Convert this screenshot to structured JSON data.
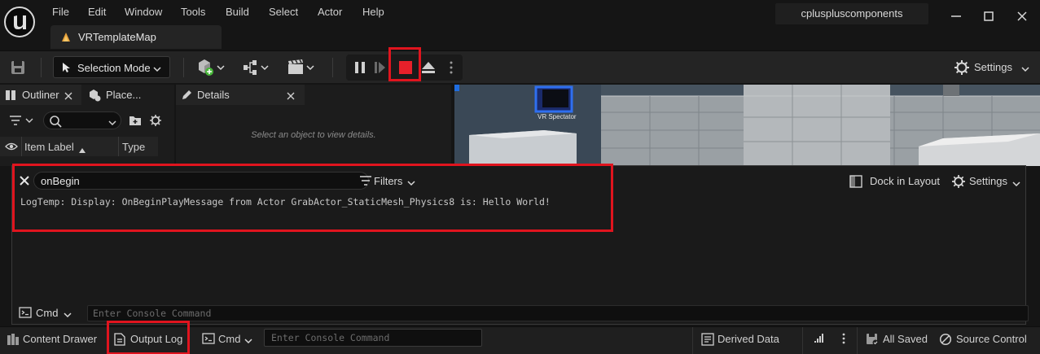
{
  "menu": [
    "File",
    "Edit",
    "Window",
    "Tools",
    "Build",
    "Select",
    "Actor",
    "Help"
  ],
  "project_name": "cpluspluscomponents",
  "level_tab": {
    "label": "VRTemplateMap"
  },
  "toolbar": {
    "selection_mode": "Selection Mode",
    "settings_label": "Settings"
  },
  "outliner": {
    "tab_outliner": "Outliner",
    "tab_place": "Place...",
    "col_item_label": "Item Label",
    "col_type": "Type"
  },
  "details": {
    "tab_label": "Details",
    "empty_message": "Select an object to view details."
  },
  "viewport": {
    "spectator_label": "VR Spectator"
  },
  "output_log": {
    "filter_value": "onBegin",
    "filters_label": "Filters",
    "dock_label": "Dock in Layout",
    "settings_label": "Settings",
    "lines": [
      "LogTemp: Display: OnBeginPlayMessage from Actor GrabActor_StaticMesh_Physics8 is: Hello World!"
    ],
    "cmd_label": "Cmd",
    "cmd_placeholder": "Enter Console Command"
  },
  "statusbar": {
    "content_drawer": "Content Drawer",
    "output_log": "Output Log",
    "cmd_label": "Cmd",
    "cmd_placeholder": "Enter Console Command",
    "derived_data": "Derived Data",
    "all_saved": "All Saved",
    "source_control": "Source Control"
  },
  "colors": {
    "highlight": "#e0141e",
    "stop_button": "#e8202a",
    "accent_orange": "#e8a23a",
    "add_green": "#48b63a"
  }
}
